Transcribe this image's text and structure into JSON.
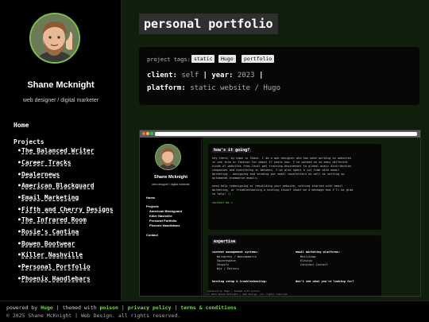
{
  "sidebar": {
    "author_name": "Shane Mcknight",
    "author_tagline": "web designer / digital marketer",
    "nav_home": "Home",
    "projects_heading": "Projects",
    "bullet": "•",
    "projects": [
      "The Balanced Writer",
      "Career Tracks",
      "Dealernews",
      "American Blackguard",
      "Email Marketing",
      "Fifth and Cherry Designs",
      "The Infrared Room",
      "Rosie's Cantina",
      "Bowen Bootwear",
      "Killer Nashville",
      "Personal Portfolio",
      "Phoenix Handlebars"
    ]
  },
  "main": {
    "page_title": "personal portfolio",
    "tags_label": "project tags:",
    "tags": [
      "static",
      "Hugo",
      "portfolio"
    ],
    "client_key": "client:",
    "client_value": "self",
    "sep": "|",
    "year_key": "year:",
    "year_value": "2023",
    "platform_key": "platform:",
    "platform_value": "static website / Hugo"
  },
  "preview": {
    "author_name": "Shane Mcknight",
    "author_tagline": "web designer / digital marketer",
    "nav_home": "Home",
    "projects_heading": "Projects",
    "projects": [
      "American Blackguard",
      "Killer Nashville",
      "Personal Portfolio",
      "Phoenix Handlebars"
    ],
    "nav_contact": "Contact",
    "about_heading": "how's it going?",
    "about_lines": [
      "hey there, my name is Shane. I am a web designer who has been working on websites",
      "in one form or fashion for about 17 years now. I've worked on so many different",
      "kinds of websites from local pet training businesses to global music distribution",
      "companies and everything in between. I've also spent a lot time with email",
      "marketing - designing and sending out email newsletters as well as setting up",
      "automated ecommerce emails."
    ],
    "about_lines2": [
      "need help redesigning or rebuilding your website, setting started with email",
      "marketing, or troubleshooting a hosting issue? shoot me a message and I'll be glad",
      "to help! :)"
    ],
    "contact_link": "contact me >",
    "expertise_heading": "expertise",
    "cms_heading": "content management systems:",
    "cms_items": [
      "Wordpress / Woocommerce",
      "Squarespace",
      "Shopify",
      "Wix / Editorx"
    ],
    "email_heading": "email marketing platforms:",
    "email_items": [
      "Mailchimp",
      "Klaviyo",
      "Constant Contact"
    ],
    "hosting_heading": "hosting setup & troubleshooting:",
    "dont_see": "don't see what you're looking for?",
    "footer1": "powered by Hugo | themed with poison",
    "footer2": "© 2023 Shane McKnight | Web Design. all rights reserved."
  },
  "footer": {
    "powered_by": "powered by",
    "hugo": "Hugo",
    "themed_with": "themed with",
    "poison": "poison",
    "privacy": "privacy policy",
    "terms": "terms & conditions",
    "copyright": "© 2025 Shane McKnight | Web Design. all rights reserved."
  },
  "colors": {
    "accent": "#7cd94a",
    "main_bg": "#101e0c",
    "sidebar_bg": "#000000"
  }
}
